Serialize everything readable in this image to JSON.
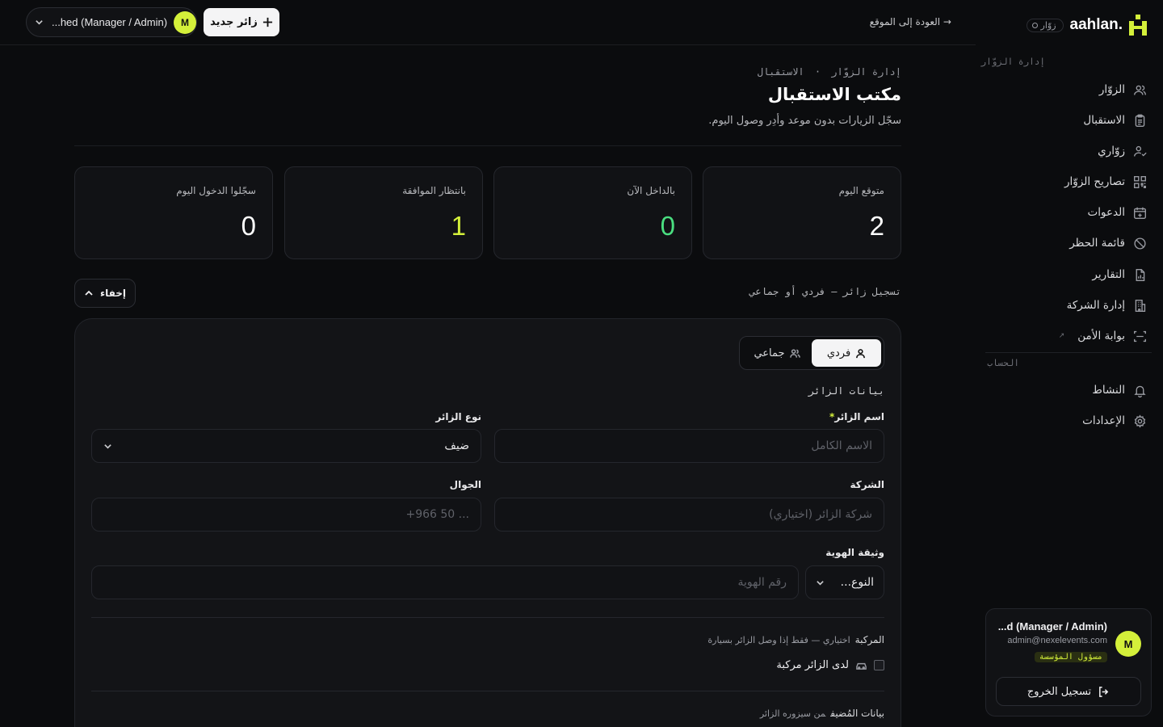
{
  "brand": {
    "name": "aahlan.",
    "badge": "زوّار"
  },
  "sidebar": {
    "section_visitors": "إدارة الزوّار",
    "items": [
      {
        "label": "الزوّار",
        "icon": "users-icon"
      },
      {
        "label": "الاستقبال",
        "icon": "clipboard-icon"
      },
      {
        "label": "زوّاري",
        "icon": "user-check-icon"
      },
      {
        "label": "تصاريح الزوّار",
        "icon": "qr-icon"
      },
      {
        "label": "الدعوات",
        "icon": "calendar-plus-icon"
      },
      {
        "label": "قائمة الحظر",
        "icon": "ban-icon"
      },
      {
        "label": "التقارير",
        "icon": "report-icon"
      },
      {
        "label": "إدارة الشركة",
        "icon": "building-icon"
      },
      {
        "label": "بوابة الأمن",
        "icon": "scan-icon",
        "external": "↗"
      }
    ],
    "section_account": "الحساب",
    "account_items": [
      {
        "label": "النشاط",
        "icon": "bell-icon"
      },
      {
        "label": "الإعدادات",
        "icon": "gear-icon"
      }
    ],
    "account": {
      "avatar": "M",
      "name": "...d (Manager / Admin)",
      "email": "admin@nexelevents.com",
      "role": "مسؤول المؤسسة",
      "logout": "تسجيل الخروج"
    }
  },
  "topbar": {
    "back": "→ العودة إلى الموقع",
    "user_avatar": "M",
    "user_name": "...hed (Manager / Admin)",
    "new_visitor": "زائر جديد"
  },
  "page": {
    "breadcrumb_root": "إدارة الزوّار",
    "breadcrumb_sep": "·",
    "breadcrumb_current": "الاستقبال",
    "title": "مكتب الاستقبال",
    "subtitle": "سجّل الزيارات بدون موعد وأدِر وصول اليوم."
  },
  "stats": [
    {
      "label": "متوقع اليوم",
      "value": "2",
      "color": "#ffffff"
    },
    {
      "label": "بالداخل الآن",
      "value": "0",
      "color": "#4ade80"
    },
    {
      "label": "بانتظار الموافقة",
      "value": "1",
      "color": "#d4f03a"
    },
    {
      "label": "سجّلوا الدخول اليوم",
      "value": "0",
      "color": "#ffffff"
    }
  ],
  "register": {
    "label": "تسجيل زائر — فردي أو جماعي",
    "hide": "إخفاء",
    "toggle_individual": "فردي",
    "toggle_group": "جماعي",
    "section_visitor": "بيانات الزائر",
    "name_label": "اسم الزائر",
    "name_required": "*",
    "name_placeholder": "الاسم الكامل",
    "type_label": "نوع الزائر",
    "type_value": "ضيف",
    "company_label": "الشركة",
    "company_placeholder": "شركة الزائر (اختياري)",
    "mobile_label": "الجوال",
    "mobile_placeholder": "+966 50 ...",
    "id_label": "وثيقة الهوية",
    "id_type_placeholder": "النوع...",
    "id_number_placeholder": "رقم الهوية",
    "vehicle_section": "المركبة",
    "vehicle_note": "اختياري — فقط إذا وصل الزائر بسيارة",
    "vehicle_checkbox": "لدى الزائر مركبة",
    "host_section": "بيانات المُضيف",
    "host_note": "من سيزوره الزائر"
  }
}
